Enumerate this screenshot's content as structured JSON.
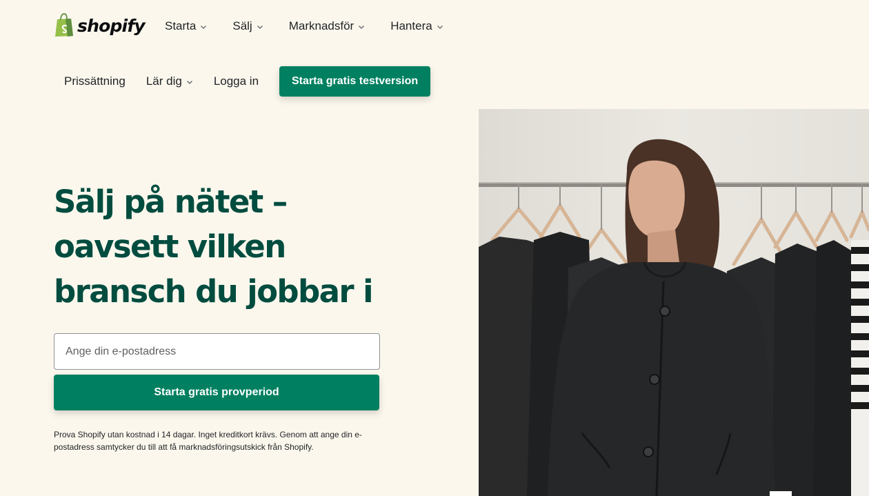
{
  "brand": {
    "name": "shopify",
    "logo_icon": "shopping-bag-icon",
    "logo_color": "#95bf47"
  },
  "nav": {
    "primary": [
      {
        "label": "Starta",
        "has_dropdown": true
      },
      {
        "label": "Sälj",
        "has_dropdown": true
      },
      {
        "label": "Marknadsför",
        "has_dropdown": true
      },
      {
        "label": "Hantera",
        "has_dropdown": true
      }
    ],
    "secondary": [
      {
        "label": "Prissättning",
        "has_dropdown": false
      },
      {
        "label": "Lär dig",
        "has_dropdown": true
      },
      {
        "label": "Logga in",
        "has_dropdown": false
      }
    ],
    "cta_label": "Starta gratis testversion"
  },
  "hero": {
    "title": "Sälj på nätet – oavsett vilken bransch du jobbar i",
    "email_placeholder": "Ange din e-postadress",
    "email_value": "",
    "cta_label": "Starta gratis provperiod",
    "disclaimer": "Prova Shopify utan kostnad i 14 dagar. Inget kreditkort krävs. Genom att ange din e-postadress samtycker du till att få marknadsföringsutskick från Shopify."
  },
  "colors": {
    "background": "#fbf7ed",
    "accent": "#008060",
    "heading": "#004c3f"
  }
}
